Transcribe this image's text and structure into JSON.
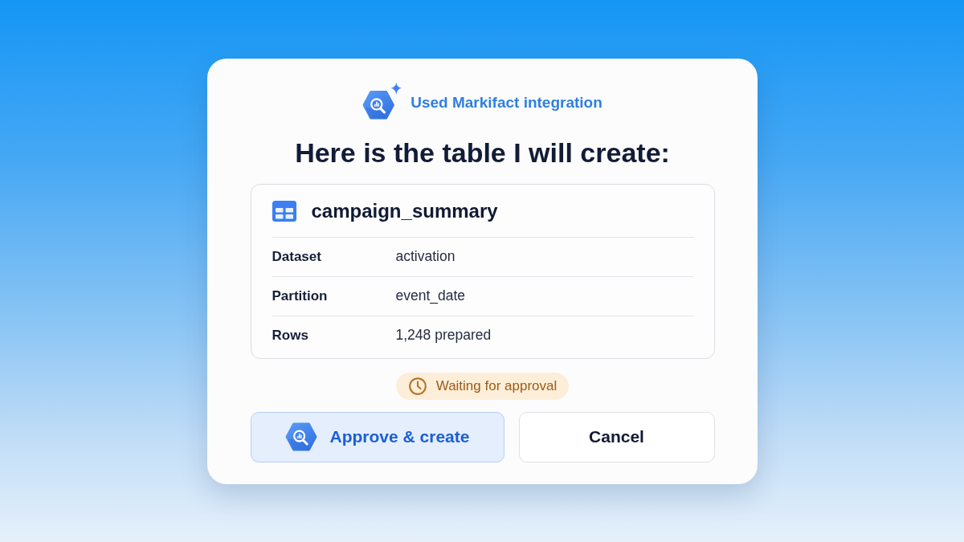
{
  "integration": {
    "label": "Used Markifact integration"
  },
  "title": "Here is the table I will create:",
  "table_card": {
    "name": "campaign_summary",
    "rows": [
      {
        "label": "Dataset",
        "value": "activation"
      },
      {
        "label": "Partition",
        "value": "event_date"
      },
      {
        "label": "Rows",
        "value": "1,248 prepared"
      }
    ]
  },
  "status_badge": {
    "label": "Waiting for approval"
  },
  "buttons": [
    {
      "label": "Approve & create",
      "kind": "primary"
    },
    {
      "label": "Cancel",
      "kind": "secondary"
    }
  ]
}
